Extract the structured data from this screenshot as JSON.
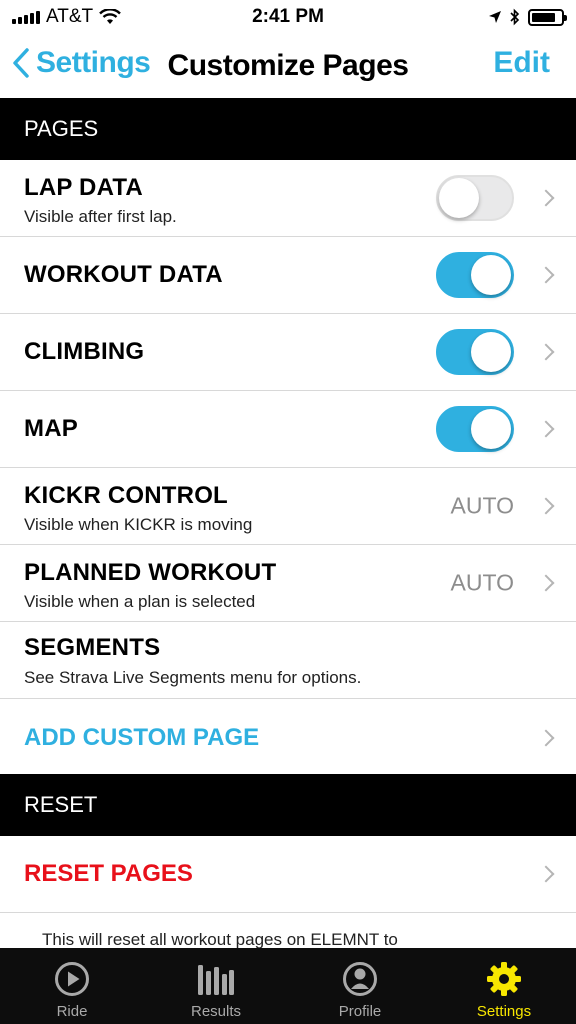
{
  "status_bar": {
    "carrier": "AT&T",
    "time": "2:41 PM"
  },
  "nav": {
    "back_label": "Settings",
    "title": "Customize Pages",
    "edit_label": "Edit"
  },
  "sections": {
    "pages_header": "PAGES",
    "reset_header": "RESET"
  },
  "pages": [
    {
      "title": "LAP DATA",
      "subtitle": "Visible after first lap.",
      "toggle": "off"
    },
    {
      "title": "WORKOUT DATA",
      "toggle": "on"
    },
    {
      "title": "CLIMBING",
      "toggle": "on"
    },
    {
      "title": "MAP",
      "toggle": "on"
    },
    {
      "title": "KICKR CONTROL",
      "subtitle": "Visible when KICKR is moving",
      "value": "AUTO"
    },
    {
      "title": "PLANNED WORKOUT",
      "subtitle": "Visible when a plan is selected",
      "value": "AUTO"
    },
    {
      "title": "SEGMENTS",
      "subtitle": "See Strava Live Segments menu for options."
    }
  ],
  "add_custom_page": "ADD CUSTOM PAGE",
  "reset_pages": "RESET PAGES",
  "reset_note": "This will reset all workout pages on ELEMNT to",
  "tabs": [
    {
      "label": "Ride",
      "icon": "play-circle-icon"
    },
    {
      "label": "Results",
      "icon": "bar-chart-icon"
    },
    {
      "label": "Profile",
      "icon": "profile-icon"
    },
    {
      "label": "Settings",
      "icon": "gear-icon",
      "active": true
    }
  ],
  "colors": {
    "accent": "#2fb0e0",
    "danger": "#e8101a",
    "tab_active": "#f7e600",
    "header_bg": "#000000"
  }
}
